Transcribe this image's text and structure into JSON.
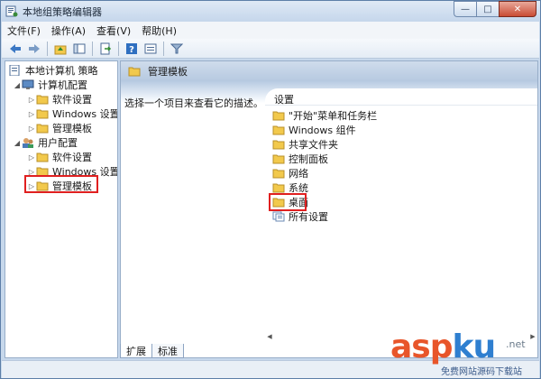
{
  "window": {
    "title": "本地组策略编辑器",
    "caption": {
      "minimize": "—",
      "maximize": "□",
      "close": "✕"
    }
  },
  "menubar": {
    "items": [
      {
        "label": "文件(F)"
      },
      {
        "label": "操作(A)"
      },
      {
        "label": "查看(V)"
      },
      {
        "label": "帮助(H)"
      }
    ]
  },
  "toolbar": {
    "buttons": [
      "back-icon",
      "forward-icon",
      "up-folder-icon",
      "show-hide-tree-icon",
      "export-list-icon",
      "help-icon",
      "properties-icon",
      "filter-icon"
    ]
  },
  "tree": {
    "root": {
      "label": "本地计算机 策略"
    },
    "computer_config": {
      "label": "计算机配置"
    },
    "computer_children": [
      {
        "label": "软件设置"
      },
      {
        "label": "Windows 设置"
      },
      {
        "label": "管理模板"
      }
    ],
    "user_config": {
      "label": "用户配置"
    },
    "user_children": [
      {
        "label": "软件设置"
      },
      {
        "label": "Windows 设置"
      },
      {
        "label": "管理模板"
      }
    ]
  },
  "right_pane": {
    "header_title": "管理模板",
    "description": "选择一个项目来查看它的描述。",
    "column_header": "设置",
    "items": [
      {
        "label": "\"开始\"菜单和任务栏"
      },
      {
        "label": "Windows 组件"
      },
      {
        "label": "共享文件夹"
      },
      {
        "label": "控制面板"
      },
      {
        "label": "网络"
      },
      {
        "label": "系统"
      },
      {
        "label": "桌面"
      },
      {
        "label": "所有设置"
      }
    ]
  },
  "tabs": [
    {
      "label": "扩展"
    },
    {
      "label": "标准"
    }
  ],
  "watermark": {
    "logo_asp": "asp",
    "logo_ku": "ku",
    "net": ".net",
    "subtitle": "免费网站源码下载站"
  },
  "colors": {
    "highlight_red": "#e02020",
    "folder_yellow": "#f2c94c",
    "title_bg": "#c7d8ec"
  }
}
